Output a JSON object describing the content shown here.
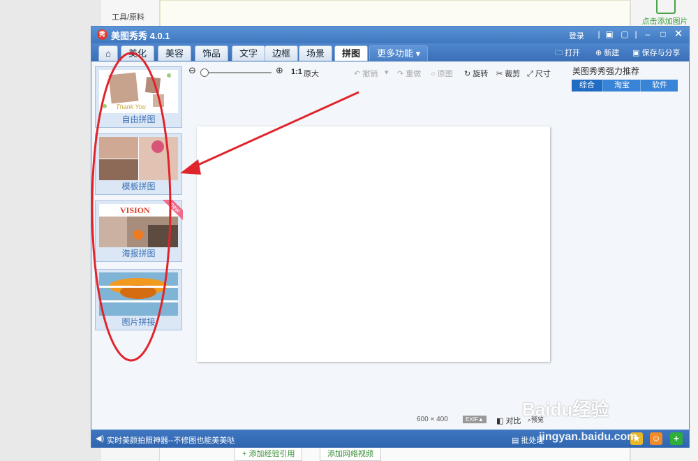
{
  "background": {
    "side_label": "工具/原料",
    "add_image_label": "点击添加图片",
    "bottom_buttons": [
      "+ 添加经验引用",
      "添加网络视频"
    ]
  },
  "window": {
    "title": "美图秀秀 4.0.1",
    "login_label": "登录",
    "menu_tabs": [
      "美化",
      "美容",
      "饰品",
      "文字",
      "边框",
      "场景",
      "拼图"
    ],
    "active_tab": "拼图",
    "more_label": "更多功能 ▾",
    "actions": {
      "open": "打开",
      "new": "新建",
      "save_share": "保存与分享"
    }
  },
  "toolbar": {
    "ratio_label": "1:1",
    "original_size": "原大",
    "undo": "撤销",
    "redo": "重做",
    "original": "原图",
    "rotate": "旋转",
    "crop": "裁剪",
    "size": "尺寸"
  },
  "left_panel": {
    "items": [
      {
        "label": "自由拼图",
        "thumb_text": "Thank You"
      },
      {
        "label": "模板拼图"
      },
      {
        "label": "海报拼图",
        "thumb_text": "VISION",
        "badge": "new"
      },
      {
        "label": "图片拼接"
      }
    ]
  },
  "right_panel": {
    "title": "美图秀秀强力推荐",
    "tabs": [
      "综合",
      "淘宝",
      "软件"
    ],
    "active_tab": "综合"
  },
  "status": {
    "width": "600",
    "times": "×",
    "height": "400",
    "exif": "EXIF▲",
    "compare": "对比",
    "preview": "预览"
  },
  "bottom_bar": {
    "message": "实时美颜拍照神器--不修图也能美美哒",
    "batch": "批处理"
  },
  "watermark": "Baidu经验",
  "watermark_sub": "jingyan.baidu.com",
  "colors": {
    "title_blue": "#4a80c6",
    "accent_red": "#e03b2f",
    "tab_active_blue": "#1f6cc2"
  }
}
